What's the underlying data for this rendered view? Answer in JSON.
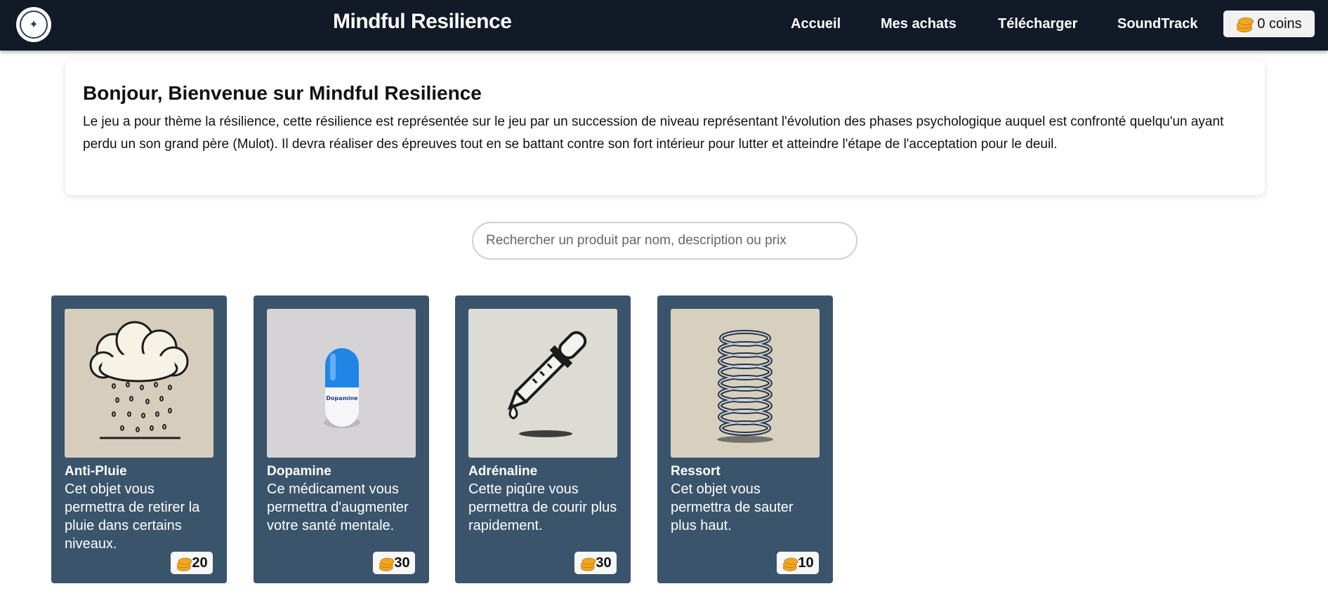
{
  "header": {
    "title": "Mindful Resilience",
    "nav": [
      "Accueil",
      "Mes achats",
      "Télécharger",
      "SoundTrack"
    ],
    "coins_label": "0 coins"
  },
  "welcome": {
    "heading": "Bonjour, Bienvenue sur Mindful Resilience",
    "text": "Le jeu a pour thème la résilience, cette résilience est représentée sur le jeu par un succession de niveau représentant l'évolution des phases psychologique auquel est confronté quelqu'un ayant perdu un son grand père (Mulot). Il devra réaliser des épreuves tout en se battant contre son fort intérieur pour lutter et atteindre l'étape de l'acceptation pour le deuil."
  },
  "search": {
    "placeholder": "Rechercher un produit par nom, description ou prix"
  },
  "products": [
    {
      "name": "Anti-Pluie",
      "description": "Cet objet vous permettra de retirer la pluie dans certains niveaux.",
      "price": "20",
      "image": "rain-cloud-image",
      "pill_text": ""
    },
    {
      "name": "Dopamine",
      "description": "Ce médicament vous permettra d'augmenter votre santé mentale.",
      "price": "30",
      "image": "pill-image",
      "pill_text": "Dopamine"
    },
    {
      "name": "Adrénaline",
      "description": "Cette piqûre vous permettra de courir plus rapidement.",
      "price": "30",
      "image": "dropper-image",
      "pill_text": ""
    },
    {
      "name": "Ressort",
      "description": "Cet objet vous permettra de sauter plus haut.",
      "price": "10",
      "image": "spring-image",
      "pill_text": ""
    }
  ],
  "colors": {
    "header_bg": "#121a28",
    "card_bg": "#3a546b",
    "coin": "#f0a824"
  }
}
